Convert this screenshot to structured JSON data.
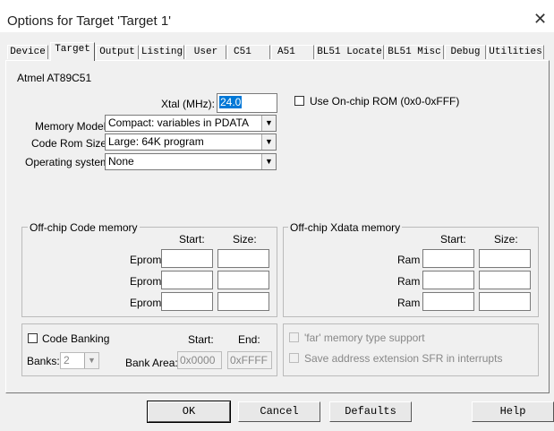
{
  "window": {
    "title": "Options for Target 'Target 1'",
    "close_glyph": "✕"
  },
  "tabs": [
    {
      "label": "Device",
      "active": false
    },
    {
      "label": "Target",
      "active": true
    },
    {
      "label": "Output",
      "active": false
    },
    {
      "label": "Listing",
      "active": false
    },
    {
      "label": "User",
      "active": false
    },
    {
      "label": "C51",
      "active": false
    },
    {
      "label": "A51",
      "active": false
    },
    {
      "label": "BL51 Locate",
      "active": false
    },
    {
      "label": "BL51 Misc",
      "active": false
    },
    {
      "label": "Debug",
      "active": false
    },
    {
      "label": "Utilities",
      "active": false
    }
  ],
  "device_name": "Atmel AT89C51",
  "xtal": {
    "label": "Xtal (MHz):",
    "value": "24.0"
  },
  "onchip_rom": {
    "label": "Use On-chip ROM (0x0-0xFFF)",
    "checked": false
  },
  "memory_model": {
    "label": "Memory Model:",
    "value": "Compact: variables in PDATA"
  },
  "code_rom_size": {
    "label": "Code Rom Size:",
    "value": "Large: 64K program"
  },
  "operating_system": {
    "label": "Operating system:",
    "value": "None"
  },
  "offchip_code": {
    "title": "Off-chip Code memory",
    "start_header": "Start:",
    "size_header": "Size:",
    "rows": [
      {
        "label": "Eprom",
        "start": "",
        "size": ""
      },
      {
        "label": "Eprom",
        "start": "",
        "size": ""
      },
      {
        "label": "Eprom",
        "start": "",
        "size": ""
      }
    ]
  },
  "offchip_xdata": {
    "title": "Off-chip Xdata memory",
    "start_header": "Start:",
    "size_header": "Size:",
    "rows": [
      {
        "label": "Ram",
        "start": "",
        "size": ""
      },
      {
        "label": "Ram",
        "start": "",
        "size": ""
      },
      {
        "label": "Ram",
        "start": "",
        "size": ""
      }
    ]
  },
  "code_banking": {
    "label": "Code Banking",
    "checked": false,
    "banks_label": "Banks:",
    "banks_value": "2",
    "bank_area_label": "Bank Area:",
    "start_header": "Start:",
    "end_header": "End:",
    "start_value": "0x0000",
    "end_value": "0xFFFF"
  },
  "far_memory": {
    "label": "'far' memory type support",
    "checked": false
  },
  "save_sfr": {
    "label": "Save address extension SFR in interrupts",
    "checked": false
  },
  "buttons": {
    "ok": "OK",
    "cancel": "Cancel",
    "defaults": "Defaults",
    "help": "Help"
  },
  "colors": {
    "selection": "#0078d7",
    "dialog_bg": "#f0f0f0"
  }
}
